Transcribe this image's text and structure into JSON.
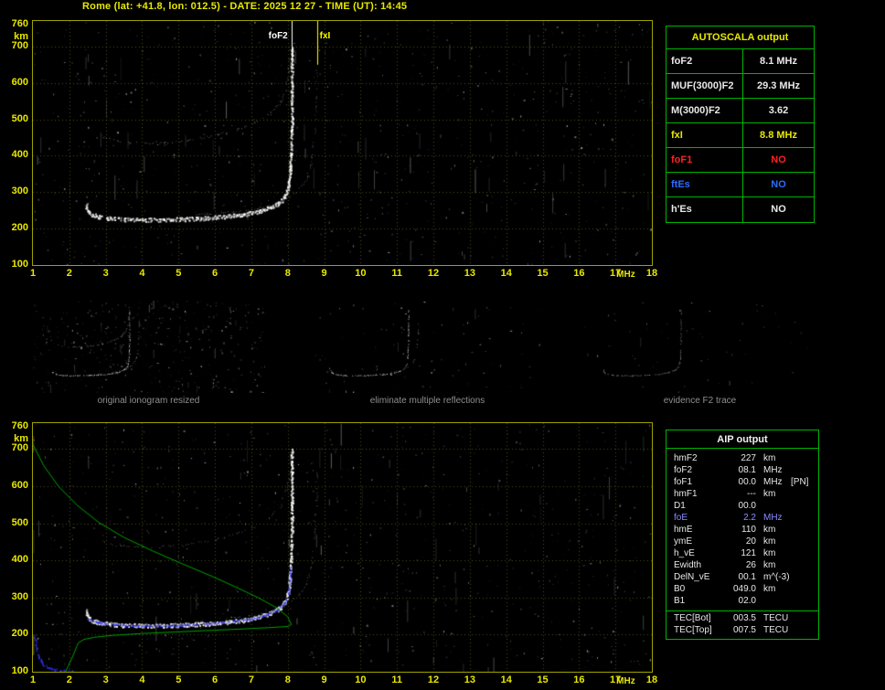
{
  "header": {
    "title": "Rome (lat: +41.8, lon: 012.5) - DATE: 2025 12 27 - TIME (UT): 14:45"
  },
  "colors": {
    "background": "#000000",
    "axis_labels": "#e8e800",
    "plot_border": "#a0a000",
    "panel_border": "#00b400",
    "trace_white": "#ffffff",
    "profile_green": "#00aa00",
    "restored_blue": "#3434ff",
    "foF2_marker": "#ffffff",
    "fxI_marker": "#ffff00",
    "caption_gray": "#8f8f8f"
  },
  "autoscala": {
    "title": "AUTOSCALA output",
    "rows": [
      {
        "label": "foF2",
        "value": "8.1 MHz",
        "color": "#e8e8e8"
      },
      {
        "label": "MUF(3000)F2",
        "value": "29.3 MHz",
        "color": "#e8e8e8"
      },
      {
        "label": "M(3000)F2",
        "value": "3.62",
        "color": "#e8e8e8"
      },
      {
        "label": "fxI",
        "value": "8.8 MHz",
        "color": "#e8e800"
      },
      {
        "label": "foF1",
        "value": "NO",
        "color": "#ff2020"
      },
      {
        "label": "ftEs",
        "value": "NO",
        "color": "#2e6bff"
      },
      {
        "label": "h'Es",
        "value": "NO",
        "color": "#e8e8e8"
      }
    ]
  },
  "thumbnails": [
    {
      "caption": "original ionogram resized",
      "noise": {
        "seed": 3,
        "speckles": 420,
        "streaks": 16
      },
      "series": [
        "F2-trace-o-mode",
        "F2-trace-x-mode",
        "second-hop-echo"
      ],
      "dim": 1.0
    },
    {
      "caption": "eliminate multiple reflections",
      "noise": {
        "seed": 4,
        "speckles": 90,
        "streaks": 5
      },
      "series": [
        "F2-trace-o-mode",
        "F2-trace-x-mode"
      ],
      "dim": 0.9
    },
    {
      "caption": "evidence F2 trace",
      "noise": {
        "seed": 5,
        "speckles": 55,
        "streaks": 3
      },
      "series": [
        "F2-trace-o-mode"
      ],
      "dim": 0.55
    }
  ],
  "aip": {
    "title": "AIP output",
    "rows": [
      {
        "name": "hmF2",
        "value": "227",
        "unit": "km",
        "note": "",
        "color": "#e8e8e8"
      },
      {
        "name": "foF2",
        "value": "08.1",
        "unit": "MHz",
        "note": "",
        "color": "#e8e8e8"
      },
      {
        "name": "foF1",
        "value": "00.0",
        "unit": "MHz",
        "note": "[PN]",
        "color": "#e8e8e8"
      },
      {
        "name": "hmF1",
        "value": "---",
        "unit": "km",
        "note": "",
        "color": "#e8e8e8"
      },
      {
        "name": "D1",
        "value": "00.0",
        "unit": "",
        "note": "",
        "color": "#e8e8e8"
      },
      {
        "name": "foE",
        "value": "2.2",
        "unit": "MHz",
        "note": "",
        "color": "#8c8cff"
      },
      {
        "name": "hmE",
        "value": "110",
        "unit": "km",
        "note": "",
        "color": "#e8e8e8"
      },
      {
        "name": "ymE",
        "value": "20",
        "unit": "km",
        "note": "",
        "color": "#e8e8e8"
      },
      {
        "name": "h_vE",
        "value": "121",
        "unit": "km",
        "note": "",
        "color": "#e8e8e8"
      },
      {
        "name": "Ewidth",
        "value": "26",
        "unit": "km",
        "note": "",
        "color": "#e8e8e8"
      },
      {
        "name": "DelN_vE",
        "value": "00.1",
        "unit": "m^(-3)",
        "note": "",
        "color": "#e8e8e8"
      },
      {
        "name": "B0",
        "value": "049.0",
        "unit": "km",
        "note": "",
        "color": "#e8e8e8"
      },
      {
        "name": "B1",
        "value": "02.0",
        "unit": "",
        "note": "",
        "color": "#e8e8e8"
      }
    ],
    "tec_rows": [
      {
        "name": "TEC[Bot]",
        "value": "003.5",
        "unit": "TECU",
        "color": "#e8e8e8"
      },
      {
        "name": "TEC[Top]",
        "value": "007.5",
        "unit": "TECU",
        "color": "#e8e8e8"
      }
    ]
  },
  "chart_data": [
    {
      "id": "scaled-ionogram",
      "type": "scatter",
      "title": "",
      "xlabel": "MHz",
      "ylabel": "km",
      "xlim": [
        1,
        18
      ],
      "ylim": [
        100,
        770
      ],
      "x_ticks": [
        1,
        2,
        3,
        4,
        5,
        6,
        7,
        8,
        9,
        10,
        11,
        12,
        13,
        14,
        15,
        16,
        17,
        18
      ],
      "y_ticks": [
        760,
        700,
        600,
        500,
        400,
        300,
        200,
        100
      ],
      "grid": true,
      "markers": [
        {
          "name": "foF2",
          "label": "foF2",
          "freq": 8.1,
          "color": "#ffffff",
          "side": "left"
        },
        {
          "name": "fxI",
          "label": "fxI",
          "freq": 8.8,
          "color": "#ffff00",
          "side": "right"
        }
      ],
      "noise": {
        "seed": 11,
        "speckles": 850,
        "streaks": 60
      },
      "series": [
        {
          "name": "F2-trace-o-mode",
          "color": "#ffffff",
          "size": 2,
          "density": 0.95,
          "jitter": 2.2,
          "alpha": 1,
          "thick": true,
          "points": [
            [
              2.45,
              268
            ],
            [
              2.5,
              252
            ],
            [
              2.6,
              242
            ],
            [
              2.8,
              236
            ],
            [
              3.1,
              232
            ],
            [
              3.5,
              229
            ],
            [
              4,
              228
            ],
            [
              4.6,
              228
            ],
            [
              5.2,
              230
            ],
            [
              5.8,
              233
            ],
            [
              6.3,
              237
            ],
            [
              6.8,
              243
            ],
            [
              7.2,
              251
            ],
            [
              7.5,
              261
            ],
            [
              7.75,
              274
            ],
            [
              7.92,
              292
            ],
            [
              8,
              318
            ],
            [
              8.05,
              355
            ],
            [
              8.08,
              410
            ],
            [
              8.1,
              480
            ],
            [
              8.1,
              560
            ],
            [
              8.1,
              700
            ]
          ]
        },
        {
          "name": "F2-trace-x-mode",
          "color": "#d8d8d8",
          "size": 1,
          "density": 0.5,
          "jitter": 2,
          "alpha": 0.5,
          "points": [
            [
              5.4,
              239
            ],
            [
              6,
              243
            ],
            [
              6.6,
              248
            ],
            [
              7.1,
              255
            ],
            [
              7.6,
              266
            ],
            [
              7.95,
              281
            ],
            [
              8.25,
              303
            ],
            [
              8.5,
              335
            ],
            [
              8.65,
              385
            ],
            [
              8.73,
              460
            ],
            [
              8.78,
              560
            ],
            [
              8.8,
              640
            ]
          ]
        },
        {
          "name": "second-hop-echo",
          "color": "#c8c8c8",
          "size": 1,
          "density": 0.55,
          "jitter": 2.5,
          "alpha": 0.6,
          "points": [
            [
              2.9,
              452
            ],
            [
              3.2,
              443
            ],
            [
              3.6,
              438
            ],
            [
              4.1,
              436
            ],
            [
              4.6,
              438
            ],
            [
              5.1,
              442
            ],
            [
              5.6,
              449
            ],
            [
              6.1,
              459
            ],
            [
              6.6,
              473
            ],
            [
              7.1,
              492
            ],
            [
              7.5,
              516
            ],
            [
              7.8,
              548
            ],
            [
              7.95,
              592
            ],
            [
              8.03,
              645
            ],
            [
              8.07,
              695
            ]
          ]
        }
      ]
    },
    {
      "id": "ionogram-with-profile",
      "type": "scatter",
      "title": "",
      "xlabel": "MHz",
      "ylabel": "km",
      "xlim": [
        1,
        18
      ],
      "ylim": [
        100,
        770
      ],
      "x_ticks": [
        1,
        2,
        3,
        4,
        5,
        6,
        7,
        8,
        9,
        10,
        11,
        12,
        13,
        14,
        15,
        16,
        17,
        18
      ],
      "y_ticks": [
        760,
        700,
        600,
        500,
        400,
        300,
        200,
        100
      ],
      "grid": true,
      "markers": [],
      "noise": {
        "seed": 23,
        "speckles": 800,
        "streaks": 50
      },
      "series": [
        {
          "name": "F2-trace-o-mode",
          "color": "#ffffff",
          "size": 2,
          "density": 0.95,
          "jitter": 2.2,
          "alpha": 1,
          "thick": true,
          "points": [
            [
              2.45,
              268
            ],
            [
              2.5,
              252
            ],
            [
              2.6,
              242
            ],
            [
              2.8,
              236
            ],
            [
              3.1,
              232
            ],
            [
              3.5,
              229
            ],
            [
              4,
              228
            ],
            [
              4.6,
              228
            ],
            [
              5.2,
              230
            ],
            [
              5.8,
              233
            ],
            [
              6.3,
              237
            ],
            [
              6.8,
              243
            ],
            [
              7.2,
              251
            ],
            [
              7.5,
              261
            ],
            [
              7.75,
              274
            ],
            [
              7.92,
              292
            ],
            [
              8,
              318
            ],
            [
              8.05,
              355
            ],
            [
              8.08,
              410
            ],
            [
              8.1,
              480
            ],
            [
              8.1,
              560
            ],
            [
              8.1,
              700
            ]
          ]
        },
        {
          "name": "F2-trace-x-mode",
          "color": "#d8d8d8",
          "size": 1,
          "density": 0.45,
          "jitter": 2,
          "alpha": 0.45,
          "points": [
            [
              5.4,
              239
            ],
            [
              6,
              243
            ],
            [
              6.6,
              248
            ],
            [
              7.1,
              255
            ],
            [
              7.6,
              266
            ],
            [
              7.95,
              281
            ],
            [
              8.25,
              303
            ],
            [
              8.5,
              335
            ],
            [
              8.65,
              385
            ],
            [
              8.73,
              460
            ],
            [
              8.78,
              560
            ],
            [
              8.8,
              640
            ]
          ]
        },
        {
          "name": "second-hop-echo",
          "color": "#c8c8c8",
          "size": 1,
          "density": 0.5,
          "jitter": 2.5,
          "alpha": 0.55,
          "points": [
            [
              2.9,
              452
            ],
            [
              3.2,
              443
            ],
            [
              3.6,
              438
            ],
            [
              4.1,
              436
            ],
            [
              4.6,
              438
            ],
            [
              5.1,
              442
            ],
            [
              5.6,
              449
            ],
            [
              6.1,
              459
            ],
            [
              6.6,
              473
            ],
            [
              7.1,
              492
            ],
            [
              7.5,
              516
            ],
            [
              7.8,
              548
            ],
            [
              7.95,
              592
            ],
            [
              8.03,
              645
            ],
            [
              8.07,
              695
            ]
          ]
        },
        {
          "name": "restored-trace",
          "color": "#3434ff",
          "size": 2,
          "density": 0.85,
          "jitter": 1.5,
          "alpha": 0.95,
          "points": [
            [
              2.5,
              244
            ],
            [
              2.8,
              234
            ],
            [
              3.2,
              229
            ],
            [
              3.7,
              226
            ],
            [
              4.2,
              225
            ],
            [
              4.8,
              226
            ],
            [
              5.4,
              229
            ],
            [
              6,
              233
            ],
            [
              6.5,
              238
            ],
            [
              7,
              245
            ],
            [
              7.4,
              255
            ],
            [
              7.7,
              268
            ],
            [
              7.9,
              286
            ],
            [
              8,
              312
            ],
            [
              8.05,
              348
            ],
            [
              8.08,
              382
            ]
          ]
        },
        {
          "name": "E-trace",
          "color": "#3434ff",
          "size": 2,
          "density": 0.7,
          "jitter": 2,
          "alpha": 0.9,
          "points": [
            [
              1.02,
              208
            ],
            [
              1.05,
              186
            ],
            [
              1.09,
              162
            ],
            [
              1.15,
              140
            ],
            [
              1.25,
              122
            ],
            [
              1.42,
              112
            ],
            [
              1.65,
              107
            ],
            [
              1.9,
              104
            ],
            [
              2.1,
              104
            ]
          ]
        },
        {
          "name": "electron-density-profile",
          "type": "line",
          "color": "#00aa00",
          "width": 1,
          "alpha": 0.95,
          "points": [
            [
              1,
              712
            ],
            [
              1.3,
              655
            ],
            [
              1.7,
              600
            ],
            [
              2.2,
              550
            ],
            [
              2.8,
              503
            ],
            [
              3.5,
              462
            ],
            [
              4.3,
              425
            ],
            [
              5.1,
              391
            ],
            [
              5.9,
              358
            ],
            [
              6.6,
              327
            ],
            [
              7.2,
              299
            ],
            [
              7.7,
              272
            ],
            [
              8,
              248
            ],
            [
              8.1,
              227
            ],
            [
              8.02,
              222
            ],
            [
              7.5,
              219
            ],
            [
              6.7,
              215
            ],
            [
              5.8,
              211
            ],
            [
              4.9,
              207
            ],
            [
              4,
              203
            ],
            [
              3.2,
              198
            ],
            [
              2.7,
              193
            ],
            [
              2.4,
              187
            ],
            [
              2.25,
              178
            ],
            [
              2.2,
              168
            ],
            [
              2.14,
              152
            ],
            [
              2.06,
              134
            ],
            [
              1.97,
              116
            ],
            [
              1.9,
              100
            ]
          ]
        }
      ]
    }
  ]
}
